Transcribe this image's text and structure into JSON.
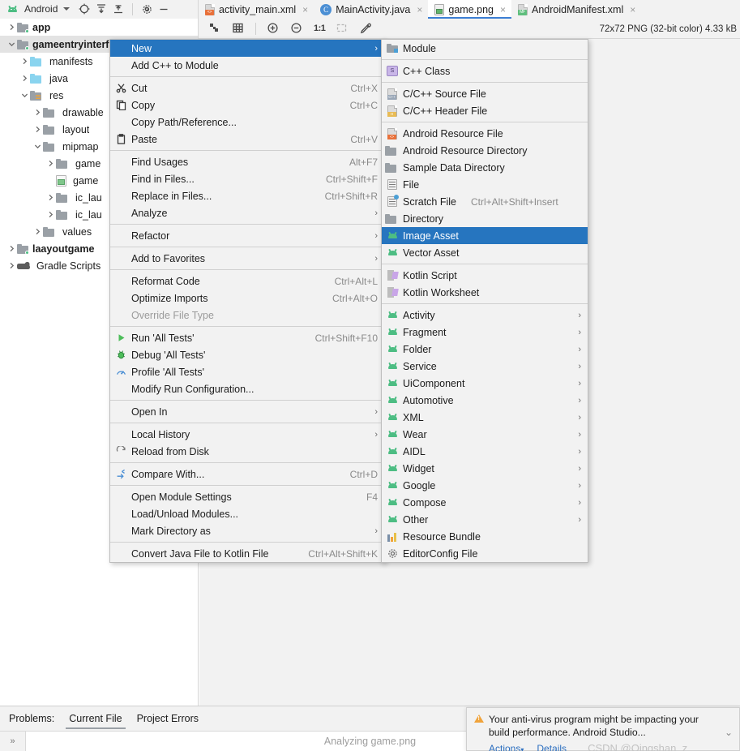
{
  "toolbar": {
    "project_label": "Android",
    "android_icon": "android-robot-icon",
    "dropdown_icon": "chevron-down-icon",
    "locate_icon": "target-crosshair-icon",
    "expand_icon": "expand-all-icon",
    "collapse_icon": "collapse-all-icon",
    "settings_icon": "gear-icon",
    "hide_icon": "minimize-icon"
  },
  "tabs": [
    {
      "label": "activity_main.xml",
      "icon": "xml-layout-file-icon",
      "active": false,
      "close": "×"
    },
    {
      "label": "MainActivity.java",
      "icon": "java-class-icon",
      "active": false,
      "close": "×"
    },
    {
      "label": "game.png",
      "icon": "image-file-icon",
      "active": true,
      "close": "×"
    },
    {
      "label": "AndroidManifest.xml",
      "icon": "manifest-file-icon",
      "active": false,
      "close": "×"
    }
  ],
  "image_toolbar": {
    "icons": [
      "transparency-grid-icon",
      "grid-icon",
      "zoom-in-icon",
      "zoom-out-icon",
      "actual-size-icon",
      "fit-to-window-icon",
      "color-picker-icon"
    ],
    "zoom_label": "1:1",
    "image_info": "72x72 PNG (32-bit color) 4.33 kB"
  },
  "project_tree": [
    {
      "label": "app",
      "depth": 0,
      "arrow": "right",
      "icon": "module-folder-icon",
      "bold": true,
      "selected": false
    },
    {
      "label": "gameentryinterface",
      "depth": 0,
      "arrow": "down",
      "icon": "module-folder-icon",
      "bold": true,
      "selected": true
    },
    {
      "label": "manifests",
      "depth": 1,
      "arrow": "right",
      "icon": "blue-folder-icon",
      "bold": false,
      "selected": false
    },
    {
      "label": "java",
      "depth": 1,
      "arrow": "right",
      "icon": "blue-folder-icon",
      "bold": false,
      "selected": false
    },
    {
      "label": "res",
      "depth": 1,
      "arrow": "down",
      "icon": "res-folder-icon",
      "bold": false,
      "selected": false
    },
    {
      "label": "drawable",
      "depth": 2,
      "arrow": "right",
      "icon": "gray-folder-icon",
      "bold": false,
      "selected": false
    },
    {
      "label": "layout",
      "depth": 2,
      "arrow": "right",
      "icon": "gray-folder-icon",
      "bold": false,
      "selected": false
    },
    {
      "label": "mipmap",
      "depth": 2,
      "arrow": "down",
      "icon": "gray-folder-icon",
      "bold": false,
      "selected": false
    },
    {
      "label": "game",
      "depth": 3,
      "arrow": "right",
      "icon": "gray-folder-icon",
      "bold": false,
      "selected": false
    },
    {
      "label": "game",
      "depth": 3,
      "arrow": "none",
      "icon": "image-file-icon",
      "bold": false,
      "selected": false
    },
    {
      "label": "ic_lau",
      "depth": 3,
      "arrow": "right",
      "icon": "gray-folder-icon",
      "bold": false,
      "selected": false
    },
    {
      "label": "ic_lau",
      "depth": 3,
      "arrow": "right",
      "icon": "gray-folder-icon",
      "bold": false,
      "selected": false
    },
    {
      "label": "values",
      "depth": 2,
      "arrow": "right",
      "icon": "gray-folder-icon",
      "bold": false,
      "selected": false
    },
    {
      "label": "laayoutgame",
      "depth": 0,
      "arrow": "right",
      "icon": "module-folder-icon",
      "bold": true,
      "selected": false
    },
    {
      "label": "Gradle Scripts",
      "depth": 0,
      "arrow": "right",
      "icon": "gradle-elephant-icon",
      "bold": false,
      "selected": false
    }
  ],
  "context_menu": [
    {
      "label": "New",
      "key": "",
      "icon": "",
      "arrow": true,
      "highlight": true,
      "sep_after": false
    },
    {
      "label": "Add C++ to Module",
      "key": "",
      "icon": "",
      "arrow": false,
      "highlight": false,
      "sep_after": true
    },
    {
      "label": "Cut",
      "key": "Ctrl+X",
      "icon": "scissors-icon",
      "arrow": false,
      "highlight": false,
      "sep_after": false
    },
    {
      "label": "Copy",
      "key": "Ctrl+C",
      "icon": "copy-icon",
      "arrow": false,
      "highlight": false,
      "sep_after": false
    },
    {
      "label": "Copy Path/Reference...",
      "key": "",
      "icon": "",
      "arrow": false,
      "highlight": false,
      "sep_after": false
    },
    {
      "label": "Paste",
      "key": "Ctrl+V",
      "icon": "clipboard-icon",
      "arrow": false,
      "highlight": false,
      "sep_after": true
    },
    {
      "label": "Find Usages",
      "key": "Alt+F7",
      "icon": "",
      "arrow": false,
      "highlight": false,
      "sep_after": false
    },
    {
      "label": "Find in Files...",
      "key": "Ctrl+Shift+F",
      "icon": "",
      "arrow": false,
      "highlight": false,
      "sep_after": false
    },
    {
      "label": "Replace in Files...",
      "key": "Ctrl+Shift+R",
      "icon": "",
      "arrow": false,
      "highlight": false,
      "sep_after": false
    },
    {
      "label": "Analyze",
      "key": "",
      "icon": "",
      "arrow": true,
      "highlight": false,
      "sep_after": true
    },
    {
      "label": "Refactor",
      "key": "",
      "icon": "",
      "arrow": true,
      "highlight": false,
      "sep_after": true
    },
    {
      "label": "Add to Favorites",
      "key": "",
      "icon": "",
      "arrow": true,
      "highlight": false,
      "sep_after": true
    },
    {
      "label": "Reformat Code",
      "key": "Ctrl+Alt+L",
      "icon": "",
      "arrow": false,
      "highlight": false,
      "sep_after": false
    },
    {
      "label": "Optimize Imports",
      "key": "Ctrl+Alt+O",
      "icon": "",
      "arrow": false,
      "highlight": false,
      "sep_after": false
    },
    {
      "label": "Override File Type",
      "key": "",
      "icon": "",
      "arrow": false,
      "highlight": false,
      "disabled": true,
      "sep_after": true
    },
    {
      "label": "Run 'All Tests'",
      "key": "Ctrl+Shift+F10",
      "icon": "run-play-icon",
      "arrow": false,
      "highlight": false,
      "sep_after": false
    },
    {
      "label": "Debug 'All Tests'",
      "key": "",
      "icon": "debug-bug-icon",
      "arrow": false,
      "highlight": false,
      "sep_after": false
    },
    {
      "label": "Profile 'All Tests'",
      "key": "",
      "icon": "profile-icon",
      "arrow": false,
      "highlight": false,
      "sep_after": false
    },
    {
      "label": "Modify Run Configuration...",
      "key": "",
      "icon": "",
      "arrow": false,
      "highlight": false,
      "sep_after": true
    },
    {
      "label": "Open In",
      "key": "",
      "icon": "",
      "arrow": true,
      "highlight": false,
      "sep_after": true
    },
    {
      "label": "Local History",
      "key": "",
      "icon": "",
      "arrow": true,
      "highlight": false,
      "sep_after": false
    },
    {
      "label": "Reload from Disk",
      "key": "",
      "icon": "refresh-icon",
      "arrow": false,
      "highlight": false,
      "sep_after": true
    },
    {
      "label": "Compare With...",
      "key": "Ctrl+D",
      "icon": "compare-icon",
      "arrow": false,
      "highlight": false,
      "sep_after": true
    },
    {
      "label": "Open Module Settings",
      "key": "F4",
      "icon": "",
      "arrow": false,
      "highlight": false,
      "sep_after": false
    },
    {
      "label": "Load/Unload Modules...",
      "key": "",
      "icon": "",
      "arrow": false,
      "highlight": false,
      "sep_after": false
    },
    {
      "label": "Mark Directory as",
      "key": "",
      "icon": "",
      "arrow": true,
      "highlight": false,
      "sep_after": true
    },
    {
      "label": "Convert Java File to Kotlin File",
      "key": "Ctrl+Alt+Shift+K",
      "icon": "",
      "arrow": false,
      "highlight": false,
      "sep_after": false
    }
  ],
  "new_submenu": [
    {
      "label": "Module",
      "key": "",
      "icon": "module-folder-icon",
      "arrow": false,
      "highlight": false,
      "sep_after": true
    },
    {
      "label": "C++ Class",
      "key": "",
      "icon": "cpp-class-icon",
      "arrow": false,
      "highlight": false,
      "sep_after": true
    },
    {
      "label": "C/C++ Source File",
      "key": "",
      "icon": "cpp-source-file-icon",
      "arrow": false,
      "highlight": false,
      "sep_after": false
    },
    {
      "label": "C/C++ Header File",
      "key": "",
      "icon": "cpp-header-file-icon",
      "arrow": false,
      "highlight": false,
      "sep_after": true
    },
    {
      "label": "Android Resource File",
      "key": "",
      "icon": "android-resource-file-icon",
      "arrow": false,
      "highlight": false,
      "sep_after": false
    },
    {
      "label": "Android Resource Directory",
      "key": "",
      "icon": "gray-folder-icon",
      "arrow": false,
      "highlight": false,
      "sep_after": false
    },
    {
      "label": "Sample Data Directory",
      "key": "",
      "icon": "gray-folder-icon",
      "arrow": false,
      "highlight": false,
      "sep_after": false
    },
    {
      "label": "File",
      "key": "",
      "icon": "file-lines-icon",
      "arrow": false,
      "highlight": false,
      "sep_after": false
    },
    {
      "label": "Scratch File",
      "key": "Ctrl+Alt+Shift+Insert",
      "icon": "scratch-file-icon",
      "arrow": false,
      "highlight": false,
      "sep_after": false
    },
    {
      "label": "Directory",
      "key": "",
      "icon": "gray-folder-icon",
      "arrow": false,
      "highlight": false,
      "sep_after": false
    },
    {
      "label": "Image Asset",
      "key": "",
      "icon": "android-robot-icon",
      "arrow": false,
      "highlight": true,
      "sep_after": false
    },
    {
      "label": "Vector Asset",
      "key": "",
      "icon": "android-robot-icon",
      "arrow": false,
      "highlight": false,
      "sep_after": true
    },
    {
      "label": "Kotlin Script",
      "key": "",
      "icon": "kotlin-file-icon",
      "arrow": false,
      "highlight": false,
      "sep_after": false
    },
    {
      "label": "Kotlin Worksheet",
      "key": "",
      "icon": "kotlin-file-icon",
      "arrow": false,
      "highlight": false,
      "sep_after": true
    },
    {
      "label": "Activity",
      "key": "",
      "icon": "android-robot-icon",
      "arrow": true,
      "highlight": false,
      "sep_after": false
    },
    {
      "label": "Fragment",
      "key": "",
      "icon": "android-robot-icon",
      "arrow": true,
      "highlight": false,
      "sep_after": false
    },
    {
      "label": "Folder",
      "key": "",
      "icon": "android-robot-icon",
      "arrow": true,
      "highlight": false,
      "sep_after": false
    },
    {
      "label": "Service",
      "key": "",
      "icon": "android-robot-icon",
      "arrow": true,
      "highlight": false,
      "sep_after": false
    },
    {
      "label": "UiComponent",
      "key": "",
      "icon": "android-robot-icon",
      "arrow": true,
      "highlight": false,
      "sep_after": false
    },
    {
      "label": "Automotive",
      "key": "",
      "icon": "android-robot-icon",
      "arrow": true,
      "highlight": false,
      "sep_after": false
    },
    {
      "label": "XML",
      "key": "",
      "icon": "android-robot-icon",
      "arrow": true,
      "highlight": false,
      "sep_after": false
    },
    {
      "label": "Wear",
      "key": "",
      "icon": "android-robot-icon",
      "arrow": true,
      "highlight": false,
      "sep_after": false
    },
    {
      "label": "AIDL",
      "key": "",
      "icon": "android-robot-icon",
      "arrow": true,
      "highlight": false,
      "sep_after": false
    },
    {
      "label": "Widget",
      "key": "",
      "icon": "android-robot-icon",
      "arrow": true,
      "highlight": false,
      "sep_after": false
    },
    {
      "label": "Google",
      "key": "",
      "icon": "android-robot-icon",
      "arrow": true,
      "highlight": false,
      "sep_after": false
    },
    {
      "label": "Compose",
      "key": "",
      "icon": "android-robot-icon",
      "arrow": true,
      "highlight": false,
      "sep_after": false
    },
    {
      "label": "Other",
      "key": "",
      "icon": "android-robot-icon",
      "arrow": true,
      "highlight": false,
      "sep_after": false
    },
    {
      "label": "Resource Bundle",
      "key": "",
      "icon": "resource-bundle-icon",
      "arrow": false,
      "highlight": false,
      "sep_after": false
    },
    {
      "label": "EditorConfig File",
      "key": "",
      "icon": "gear-icon",
      "arrow": false,
      "highlight": false,
      "sep_after": false
    }
  ],
  "problems": {
    "title": "Problems:",
    "tabs": [
      {
        "label": "Current File",
        "active": true
      },
      {
        "label": "Project Errors",
        "active": false
      }
    ],
    "expand_toggle": "»"
  },
  "status": {
    "analyzing_text": "Analyzing game.png"
  },
  "notification": {
    "warn_icon": "warning-triangle-icon",
    "message": "Your anti-virus program might be impacting your build performance. Android Studio...",
    "collapse_icon": "chevron-down-icon",
    "actions_label": "Actions",
    "actions_caret": "▾",
    "details_label": "Details",
    "watermark": "CSDN @Qingshan_z"
  },
  "colors": {
    "accent_blue": "#2675bf",
    "tab_underline": "#3c7fd4",
    "android_green": "#4dbd83",
    "warn_orange": "#f0a33b",
    "link_blue": "#2c6fc0"
  }
}
